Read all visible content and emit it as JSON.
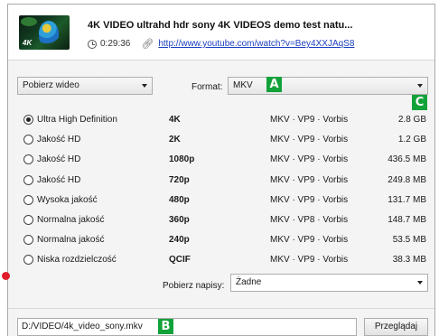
{
  "video": {
    "title": "4K VIDEO ultrahd hdr sony 4K VIDEOS demo test natu...",
    "duration": "0:29:36",
    "url": "http://www.youtube.com/watch?v=Bey4XXJAqS8",
    "thumbnail_brand": "4K"
  },
  "download_type": {
    "value": "Pobierz wideo"
  },
  "format": {
    "label": "Format:",
    "value": "MKV"
  },
  "badges": {
    "a": "A",
    "b": "B",
    "c": "C"
  },
  "qualities": [
    {
      "label": "Ultra High Definition",
      "resolution": "4K",
      "codec": "MKV · VP9 · Vorbis",
      "size": "2.8 GB",
      "selected": true
    },
    {
      "label": "Jakość HD",
      "resolution": "2K",
      "codec": "MKV · VP9 · Vorbis",
      "size": "1.2 GB",
      "selected": false
    },
    {
      "label": "Jakość HD",
      "resolution": "1080p",
      "codec": "MKV · VP9 · Vorbis",
      "size": "436.5 MB",
      "selected": false
    },
    {
      "label": "Jakość HD",
      "resolution": "720p",
      "codec": "MKV · VP9 · Vorbis",
      "size": "249.8 MB",
      "selected": false
    },
    {
      "label": "Wysoka jakość",
      "resolution": "480p",
      "codec": "MKV · VP9 · Vorbis",
      "size": "131.7 MB",
      "selected": false
    },
    {
      "label": "Normalna jakość",
      "resolution": "360p",
      "codec": "MKV · VP8 · Vorbis",
      "size": "148.7 MB",
      "selected": false
    },
    {
      "label": "Normalna jakość",
      "resolution": "240p",
      "codec": "MKV · VP9 · Vorbis",
      "size": "53.5 MB",
      "selected": false
    },
    {
      "label": "Niska rozdzielczość",
      "resolution": "QCIF",
      "codec": "MKV · VP9 · Vorbis",
      "size": "38.3 MB",
      "selected": false
    }
  ],
  "subtitles": {
    "label": "Pobierz napisy:",
    "value": "Żadne"
  },
  "output": {
    "path": "D:/VIDEO/4k_video_sony.mkv",
    "browse_label": "Przeglądaj"
  },
  "colors": {
    "badge": "#12a23a",
    "link": "#1a3fbf",
    "marker": "#e01e2a"
  }
}
